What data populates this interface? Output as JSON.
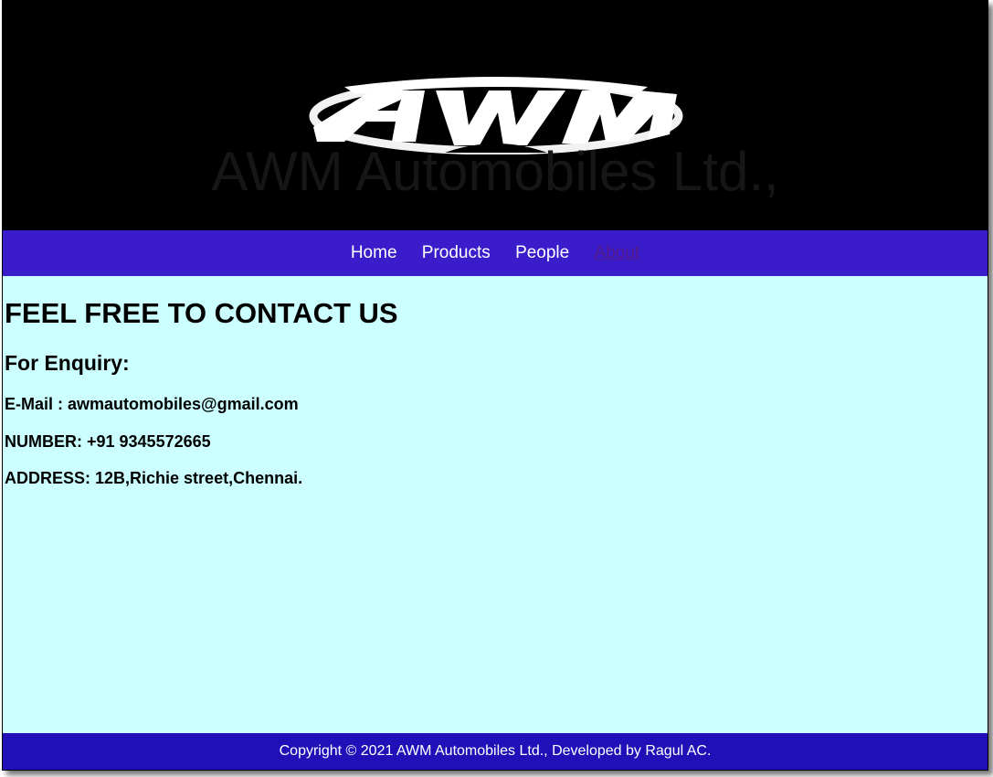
{
  "header": {
    "logo_text": "AWM",
    "site_title": "AWM Automobiles Ltd.,"
  },
  "nav": {
    "items": [
      {
        "label": "Home"
      },
      {
        "label": "Products"
      },
      {
        "label": "People"
      },
      {
        "label": "About"
      }
    ]
  },
  "main": {
    "heading": "FEEL FREE TO CONTACT US",
    "subheading": "For Enquiry:",
    "email": "E-Mail : awmautomobiles@gmail.com",
    "number": "NUMBER: +91 9345572665",
    "address": "ADDRESS: 12B,Richie street,Chennai."
  },
  "footer": {
    "copyright": "Copyright © 2021 AWM Automobiles Ltd., Developed by Ragul AC."
  },
  "colors": {
    "header_bg": "#000000",
    "nav_bg": "#3a1ccb",
    "content_bg": "#ccffff",
    "footer_bg": "#2110b8",
    "visited_link": "#551a8b"
  }
}
